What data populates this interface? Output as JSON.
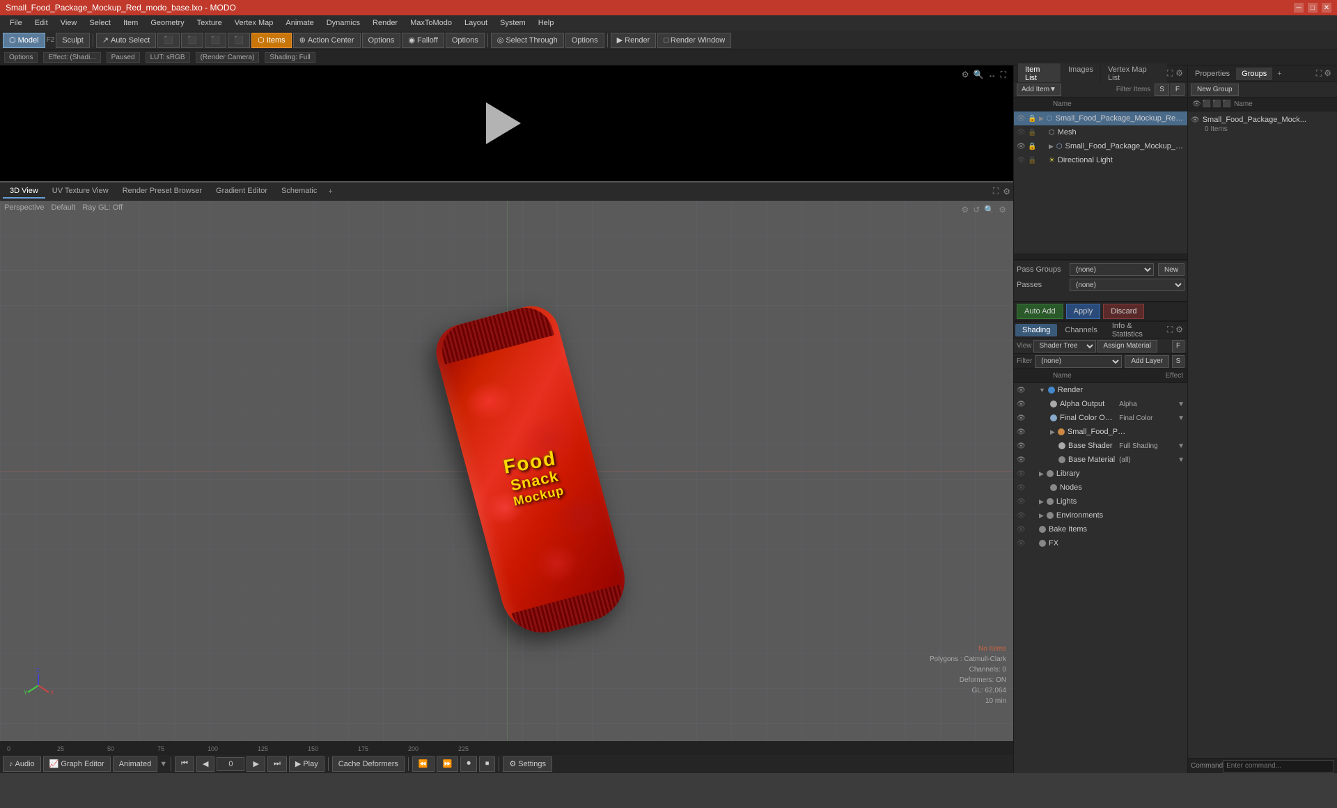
{
  "titlebar": {
    "title": "Small_Food_Package_Mockup_Red_modo_base.lxo - MODO",
    "controls": [
      "─",
      "□",
      "✕"
    ]
  },
  "menubar": {
    "items": [
      "File",
      "Edit",
      "View",
      "Select",
      "Item",
      "Geometry",
      "Texture",
      "Vertex Map",
      "Animate",
      "Dynamics",
      "Render",
      "MaxToModo",
      "Layout",
      "System",
      "Help"
    ]
  },
  "toolbar": {
    "mode_model": "Model",
    "mode_sculpt": "Sculpt",
    "auto_select": "Auto Select",
    "items_label": "Items",
    "action_center": "Action Center",
    "falloff": "Falloff",
    "options1": "Options",
    "options2": "Options",
    "select_through": "Select Through",
    "render": "Render",
    "render_window": "Render Window"
  },
  "infobar": {
    "options_label": "Options",
    "effect": "Effect: (Shadi...",
    "paused": "Paused",
    "render_camera": "(Render Camera)",
    "shading": "Shading: Full",
    "lut": "LUT: sRGB"
  },
  "viewport": {
    "tabs": [
      "3D View",
      "UV Texture View",
      "Render Preset Browser",
      "Gradient Editor",
      "Schematic"
    ],
    "mode": "Perspective",
    "default_label": "Default",
    "raygl": "Ray GL: Off",
    "stats": {
      "no_items": "No Items",
      "polygons": "Polygons : Catmull-Clark",
      "channels": "Channels: 0",
      "deformers": "Deformers: ON",
      "gl": "GL: 62,064",
      "time": "10 min"
    }
  },
  "item_list": {
    "panel_tabs": [
      "Item List",
      "Images",
      "Vertex Map List"
    ],
    "add_item_label": "Add Item",
    "filter_items": "Filter Items",
    "col_name": "Name",
    "items": [
      {
        "name": "Small_Food_Package_Mockup_Red ...",
        "indent": 0,
        "type": "mesh",
        "eye": true,
        "lock": false,
        "selected": true
      },
      {
        "name": "Mesh",
        "indent": 1,
        "type": "mesh-child",
        "eye": false,
        "lock": false
      },
      {
        "name": "Small_Food_Package_Mockup_Red ...",
        "indent": 1,
        "type": "mesh",
        "eye": true,
        "lock": false
      },
      {
        "name": "Directional Light",
        "indent": 1,
        "type": "light",
        "eye": false,
        "lock": false
      }
    ]
  },
  "pass_groups": {
    "pass_label": "Pass Groups",
    "passes_label": "Passes",
    "none_option": "(none)",
    "poses_option": "(none)",
    "new_btn": "New"
  },
  "auto_apply": {
    "auto_add": "Auto Add",
    "apply": "Apply",
    "discard": "Discard"
  },
  "properties_panel": {
    "tabs": [
      "Properties",
      "Groups"
    ],
    "new_group": "New Group",
    "col_name": "Name",
    "groups": [
      {
        "name": "Small_Food_Package_Mock...",
        "count": "0 Items"
      }
    ]
  },
  "shading_panel": {
    "tabs": [
      "Shading",
      "Channels",
      "Info & Statistics"
    ],
    "view_label": "View",
    "shader_tree": "Shader Tree",
    "assign_material": "Assign Material",
    "filter_label": "Filter",
    "none_filter": "(none)",
    "add_layer": "Add Layer",
    "col_name": "Name",
    "col_effect": "Effect",
    "f_key": "F",
    "s_key": "S",
    "layers": [
      {
        "name": "Render",
        "indent": 0,
        "type": "render",
        "eye": true,
        "expanded": true,
        "color": "#4488cc"
      },
      {
        "name": "Alpha Output",
        "indent": 1,
        "type": "output",
        "eye": true,
        "effect": "Alpha",
        "color": "#aaaaaa"
      },
      {
        "name": "Final Color Output",
        "indent": 1,
        "type": "output",
        "eye": true,
        "effect": "Final Color",
        "color": "#88aacc"
      },
      {
        "name": "Small_Food_Package_Mock ...",
        "indent": 1,
        "type": "material",
        "eye": true,
        "expanded": true,
        "color": "#cc8844"
      },
      {
        "name": "Base Shader",
        "indent": 2,
        "type": "shader",
        "eye": true,
        "effect": "Full Shading",
        "color": "#aaaaaa"
      },
      {
        "name": "Base Material",
        "indent": 2,
        "type": "material",
        "eye": true,
        "effect": "(all)",
        "color": "#888888"
      },
      {
        "name": "Library",
        "indent": 0,
        "type": "folder",
        "eye": false,
        "expanded": false,
        "color": "#888888"
      },
      {
        "name": "Nodes",
        "indent": 1,
        "type": "nodes",
        "eye": false,
        "color": "#888888"
      },
      {
        "name": "Lights",
        "indent": 0,
        "type": "folder",
        "eye": false,
        "expanded": false,
        "color": "#888888"
      },
      {
        "name": "Environments",
        "indent": 0,
        "type": "folder",
        "eye": false,
        "expanded": false,
        "color": "#888888"
      },
      {
        "name": "Bake Items",
        "indent": 0,
        "type": "folder",
        "eye": false,
        "color": "#888888"
      },
      {
        "name": "FX",
        "indent": 0,
        "type": "fx",
        "eye": false,
        "color": "#888888"
      }
    ]
  },
  "bottom_toolbar": {
    "audio": "Audio",
    "graph_editor": "Graph Editor",
    "animated": "Animated",
    "frame_current": "0",
    "play": "Play",
    "cache_deformers": "Cache Deformers",
    "settings": "Settings",
    "command_label": "Command"
  },
  "timeline": {
    "marks": [
      0,
      25,
      50,
      75,
      100,
      125,
      150,
      175,
      200,
      225
    ],
    "end": "225"
  }
}
